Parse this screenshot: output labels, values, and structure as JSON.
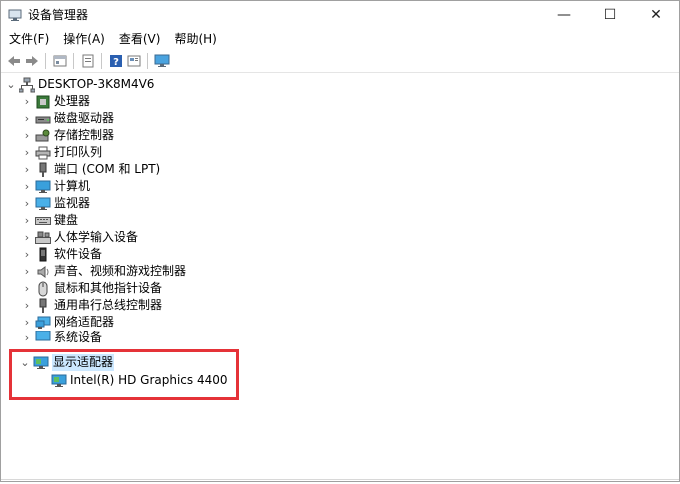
{
  "window": {
    "title": "设备管理器",
    "minimize_glyph": "—",
    "maximize_glyph": "☐",
    "close_glyph": "✕"
  },
  "menu": [
    "文件(F)",
    "操作(A)",
    "查看(V)",
    "帮助(H)"
  ],
  "toolbar": {
    "buttons": [
      "back-icon",
      "forward-icon",
      "properties-icon",
      "update-driver-icon",
      "help-icon",
      "view-icon",
      "monitor-icon"
    ]
  },
  "tree": {
    "root": {
      "label": "DESKTOP-3K8M4V6",
      "icon": "computer-network-icon",
      "expanded": true
    },
    "categories": [
      {
        "label": "处理器",
        "icon": "processor-icon"
      },
      {
        "label": "磁盘驱动器",
        "icon": "disk-drive-icon"
      },
      {
        "label": "存储控制器",
        "icon": "storage-controller-icon"
      },
      {
        "label": "打印队列",
        "icon": "printer-icon"
      },
      {
        "label": "端口 (COM 和 LPT)",
        "icon": "port-icon"
      },
      {
        "label": "计算机",
        "icon": "computer-icon"
      },
      {
        "label": "监视器",
        "icon": "monitor-icon"
      },
      {
        "label": "键盘",
        "icon": "keyboard-icon"
      },
      {
        "label": "人体学输入设备",
        "icon": "hid-icon"
      },
      {
        "label": "软件设备",
        "icon": "software-device-icon"
      },
      {
        "label": "声音、视频和游戏控制器",
        "icon": "speaker-icon"
      },
      {
        "label": "鼠标和其他指针设备",
        "icon": "mouse-icon"
      },
      {
        "label": "通用串行总线控制器",
        "icon": "usb-icon"
      },
      {
        "label": "网络适配器",
        "icon": "network-adapter-icon"
      },
      {
        "label": "系统设备",
        "icon": "system-device-icon"
      }
    ],
    "expanded_category": {
      "label": "显示适配器",
      "icon": "display-adapter-icon",
      "children": [
        {
          "label": "Intel(R) HD Graphics 4400",
          "icon": "display-adapter-icon"
        }
      ]
    }
  },
  "colors": {
    "highlight_border": "#e53238",
    "selection": "#cce8ff"
  }
}
